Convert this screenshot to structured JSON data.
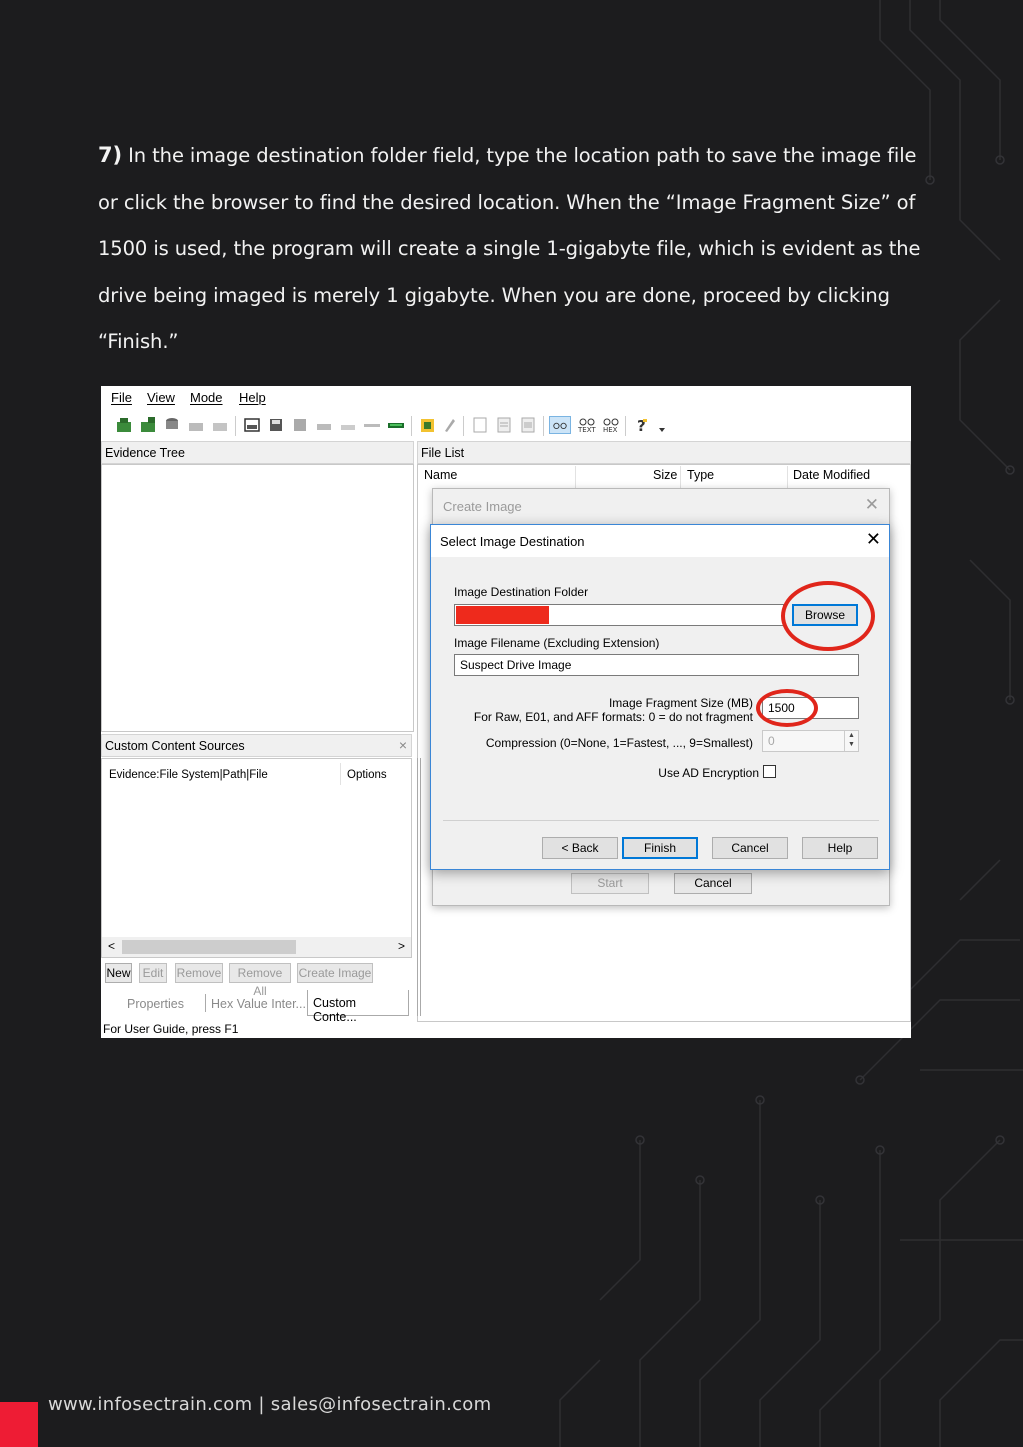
{
  "instructions": {
    "step_number": "7)",
    "text": "In the image destination folder field, type the location path to save the image file or click the browser to find the desired location. When the “Image Fragment Size” of 1500 is used, the program will create a single 1-gigabyte file, which is evident as the drive being imaged is merely 1 gigabyte. When you are done, proceed by clicking “Finish.”"
  },
  "app": {
    "menu": [
      "File",
      "View",
      "Mode",
      "Help"
    ],
    "evidence_tree_title": "Evidence Tree",
    "file_list_title": "File List",
    "file_list_columns": [
      "Name",
      "Size",
      "Type",
      "Date Modified"
    ],
    "custom_sources_title": "Custom Content Sources",
    "custom_sources_close": "×",
    "custom_sources_columns": [
      "Evidence:File System|Path|File",
      "Options"
    ],
    "custom_buttons": [
      "New",
      "Edit",
      "Remove",
      "Remove All",
      "Create Image"
    ],
    "tabs": [
      "Properties",
      "Hex Value Inter...",
      "Custom Conte..."
    ],
    "status": "For User Guide, press F1",
    "scroll_left": "<",
    "scroll_right": ">"
  },
  "create_image_dialog": {
    "title": "Create Image",
    "close": "✕",
    "start_label": "Start",
    "cancel_label": "Cancel"
  },
  "destination_dialog": {
    "title": "Select Image Destination",
    "close": "✕",
    "folder_label": "Image Destination Folder",
    "browse_label": "Browse",
    "filename_label": "Image Filename (Excluding Extension)",
    "filename_value": "Suspect Drive Image",
    "fragment_label": "Image Fragment Size (MB)",
    "fragment_note": "For Raw, E01, and AFF formats: 0 = do not fragment",
    "fragment_value": "1500",
    "compression_label": "Compression (0=None, 1=Fastest, ..., 9=Smallest)",
    "compression_value": "0",
    "encryption_label": "Use AD Encryption",
    "back_label": "< Back",
    "finish_label": "Finish",
    "cancel_label": "Cancel",
    "help_label": "Help"
  },
  "footer": {
    "text": "www.infosectrain.com | sales@infosectrain.com"
  },
  "colors": {
    "background": "#1c1c1e",
    "accent_red": "#ee1c34",
    "highlight_ring": "#e0261b",
    "redacted_field": "#ee2a1c",
    "dialog_primary": "#0078d7"
  }
}
